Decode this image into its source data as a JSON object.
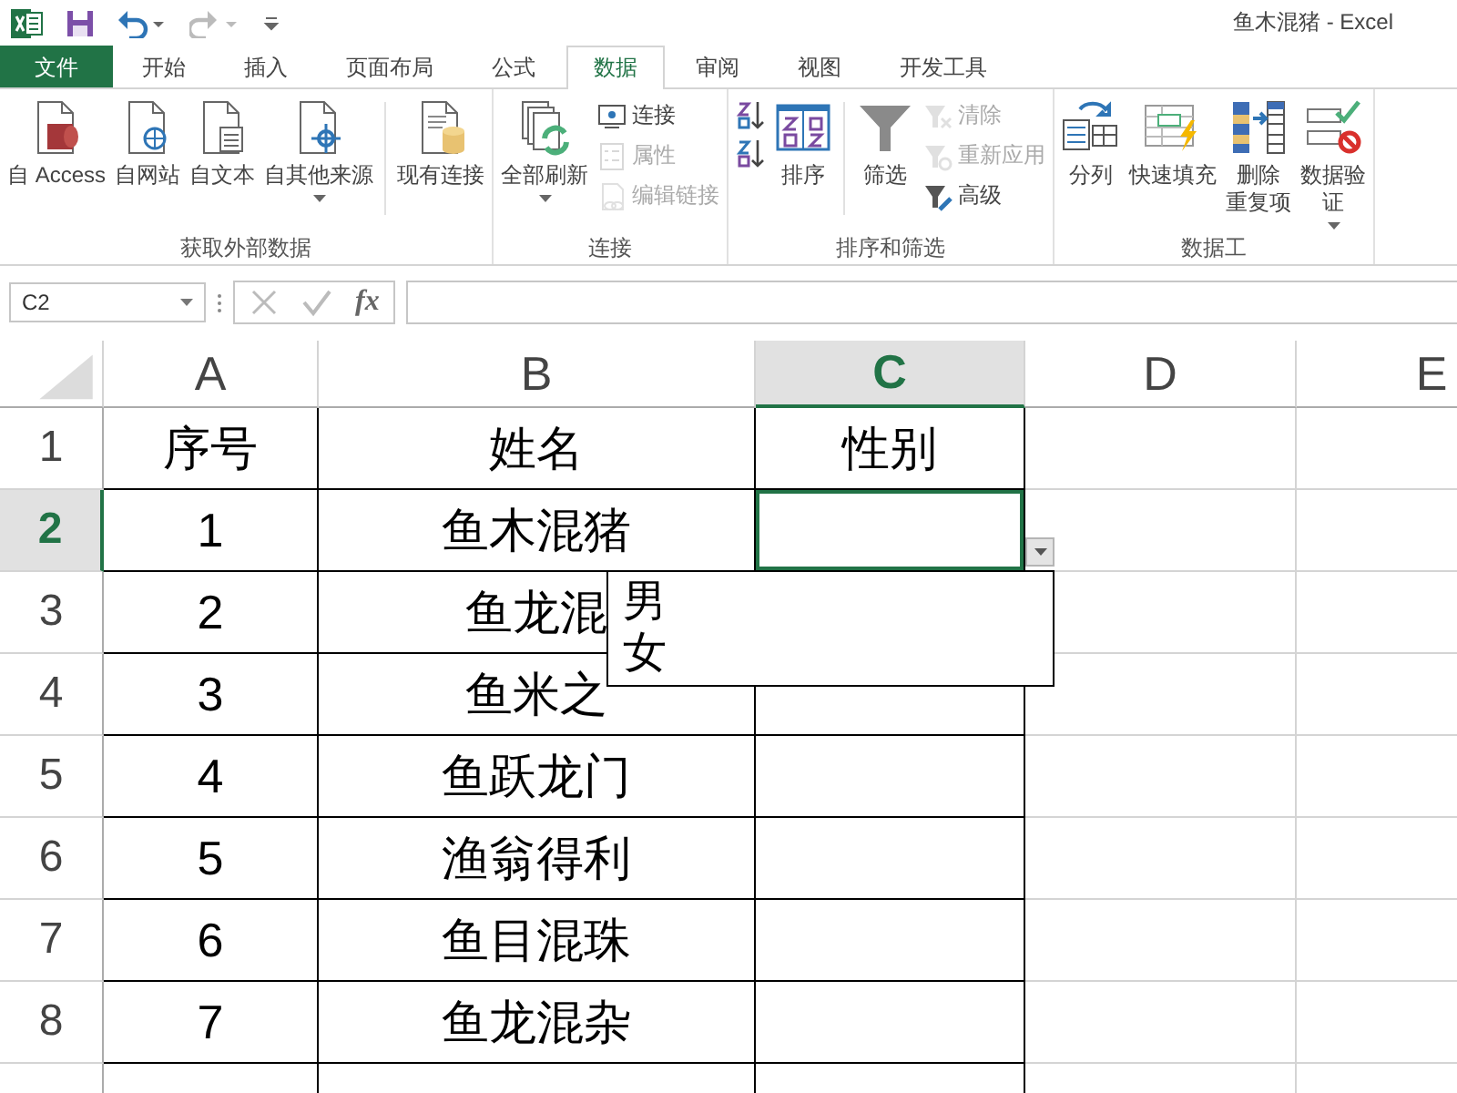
{
  "title_bar": {
    "title": "鱼木混猪 - Excel"
  },
  "tabs": [
    {
      "label": "文件",
      "kind": "file",
      "selected": false
    },
    {
      "label": "开始",
      "kind": "tab",
      "selected": false
    },
    {
      "label": "插入",
      "kind": "tab",
      "selected": false
    },
    {
      "label": "页面布局",
      "kind": "tab",
      "selected": false
    },
    {
      "label": "公式",
      "kind": "tab",
      "selected": false
    },
    {
      "label": "数据",
      "kind": "tab",
      "selected": true
    },
    {
      "label": "审阅",
      "kind": "tab",
      "selected": false
    },
    {
      "label": "视图",
      "kind": "tab",
      "selected": false
    },
    {
      "label": "开发工具",
      "kind": "tab",
      "selected": false
    }
  ],
  "ribbon": {
    "groups": [
      {
        "label": "获取外部数据",
        "items": [
          {
            "kind": "large",
            "label": "自 Access",
            "disabled": false,
            "dropdown": false
          },
          {
            "kind": "large",
            "label": "自网站",
            "disabled": false,
            "dropdown": false
          },
          {
            "kind": "large",
            "label": "自文本",
            "disabled": false,
            "dropdown": false
          },
          {
            "kind": "large",
            "label": "自其他来源",
            "disabled": false,
            "dropdown": true
          },
          {
            "kind": "separator"
          },
          {
            "kind": "large",
            "label": "现有连接",
            "disabled": false,
            "dropdown": false
          }
        ]
      },
      {
        "label": "连接",
        "items": [
          {
            "kind": "large",
            "label": "全部刷新",
            "disabled": false,
            "dropdown": true
          },
          {
            "kind": "stack",
            "items": [
              {
                "label": "连接",
                "disabled": false
              },
              {
                "label": "属性",
                "disabled": true
              },
              {
                "label": "编辑链接",
                "disabled": true
              }
            ]
          }
        ]
      },
      {
        "label": "排序和筛选",
        "items": [
          {
            "kind": "stack",
            "items": [
              {
                "disabled": false
              },
              {
                "disabled": false
              }
            ]
          },
          {
            "kind": "large",
            "label": "排序",
            "disabled": false,
            "dropdown": false
          },
          {
            "kind": "separator"
          },
          {
            "kind": "large",
            "label": "筛选",
            "disabled": false,
            "dropdown": false
          },
          {
            "kind": "stack",
            "items": [
              {
                "label": "清除",
                "disabled": true
              },
              {
                "label": "重新应用",
                "disabled": true
              },
              {
                "label": "高级",
                "disabled": false
              }
            ]
          }
        ]
      },
      {
        "label": "数据工",
        "items": [
          {
            "kind": "large",
            "label": "分列",
            "disabled": false,
            "dropdown": false
          },
          {
            "kind": "large",
            "label": "快速填充",
            "disabled": false,
            "dropdown": false
          },
          {
            "kind": "large",
            "label_lines": [
              "删除",
              "重复项"
            ],
            "disabled": false,
            "dropdown": false
          },
          {
            "kind": "large",
            "label_lines": [
              "数据验",
              "证"
            ],
            "disabled": false,
            "dropdown": true
          }
        ]
      }
    ]
  },
  "formula_bar": {
    "name_box": "C2",
    "fx": "fx"
  },
  "sheet": {
    "columns": [
      {
        "label": "A",
        "selected": false
      },
      {
        "label": "B",
        "selected": false
      },
      {
        "label": "C",
        "selected": true
      },
      {
        "label": "D",
        "selected": false
      },
      {
        "label": "E",
        "selected": false
      }
    ],
    "rows": [
      {
        "number": "1",
        "selected": false,
        "cells": [
          "序号",
          "姓名",
          "性别"
        ]
      },
      {
        "number": "2",
        "selected": true,
        "cells": [
          "1",
          "鱼木混猪"
        ]
      },
      {
        "number": "3",
        "selected": false,
        "cells": [
          "2",
          "鱼龙混"
        ]
      },
      {
        "number": "4",
        "selected": false,
        "cells": [
          "3",
          "鱼米之"
        ]
      },
      {
        "number": "5",
        "selected": false,
        "cells": [
          "4",
          "鱼跃龙门"
        ]
      },
      {
        "number": "6",
        "selected": false,
        "cells": [
          "5",
          "渔翁得利"
        ]
      },
      {
        "number": "7",
        "selected": false,
        "cells": [
          "6",
          "鱼目混珠"
        ]
      },
      {
        "number": "8",
        "selected": false,
        "cells": [
          "7",
          "鱼龙混杂"
        ]
      }
    ]
  },
  "dropdown": {
    "options": [
      "男",
      "女"
    ]
  }
}
